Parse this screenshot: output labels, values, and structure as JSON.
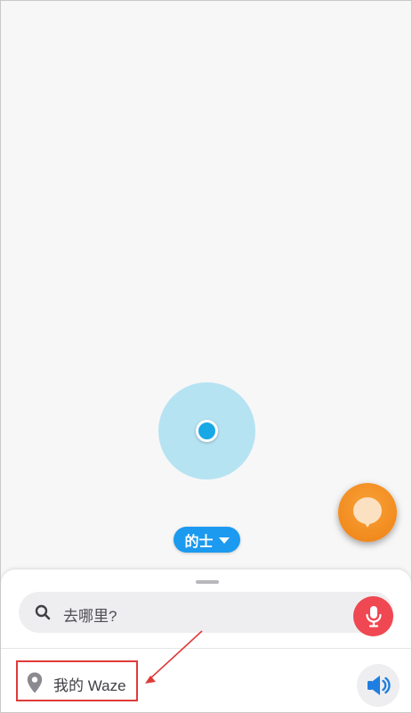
{
  "map": {
    "vehicle_label": "的士"
  },
  "sheet": {
    "search_placeholder": "去哪里?",
    "my_waze_label": "我的 Waze"
  },
  "icons": {
    "search": "search-icon",
    "mic": "microphone-icon",
    "pin": "location-pin-icon",
    "sound": "speaker-icon",
    "report": "report-bubble-icon",
    "caret": "caret-down-icon"
  },
  "colors": {
    "accuracy_circle": "#b6e3f2",
    "location_dot": "#19a8e6",
    "vehicle_chip": "#1b9aef",
    "report_button": "#f28b1e",
    "mic_button": "#ef4852",
    "annotation_red": "#e03a3a"
  }
}
